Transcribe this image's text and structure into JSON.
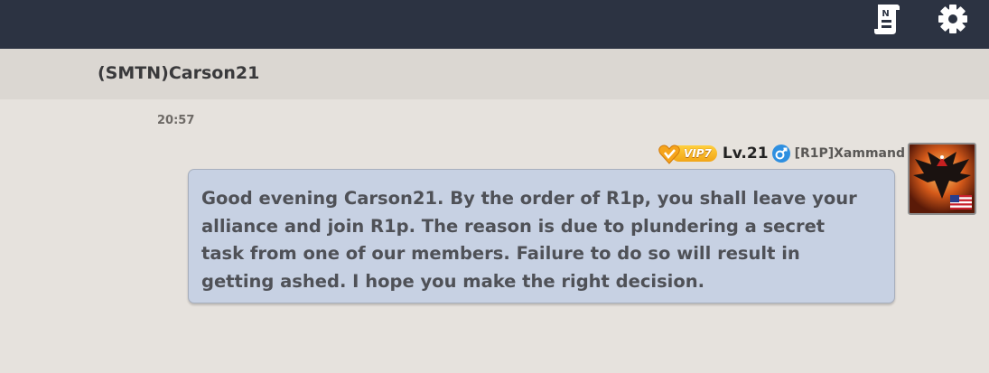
{
  "topbar": {
    "icons": [
      {
        "name": "notice-scroll-icon",
        "glyph": "N"
      },
      {
        "name": "gear-icon"
      }
    ],
    "color": "#2c3342"
  },
  "conversation": {
    "title": "(SMTN)Carson21"
  },
  "message": {
    "timestamp": "20:57",
    "vip_label": "VIP7",
    "level_label": "Lv.21",
    "sender": "[R1P]Xammand",
    "text": "Good evening Carson21. By the order of R1p, you shall leave your\nalliance and join R1p. The reason is due to plundering a secret\ntask from one of our members. Failure to do so will result in\ngetting ashed. I hope you make the right decision.",
    "bubble_color": "#c7d1e3",
    "avatar_flag": "us-flag-icon"
  }
}
